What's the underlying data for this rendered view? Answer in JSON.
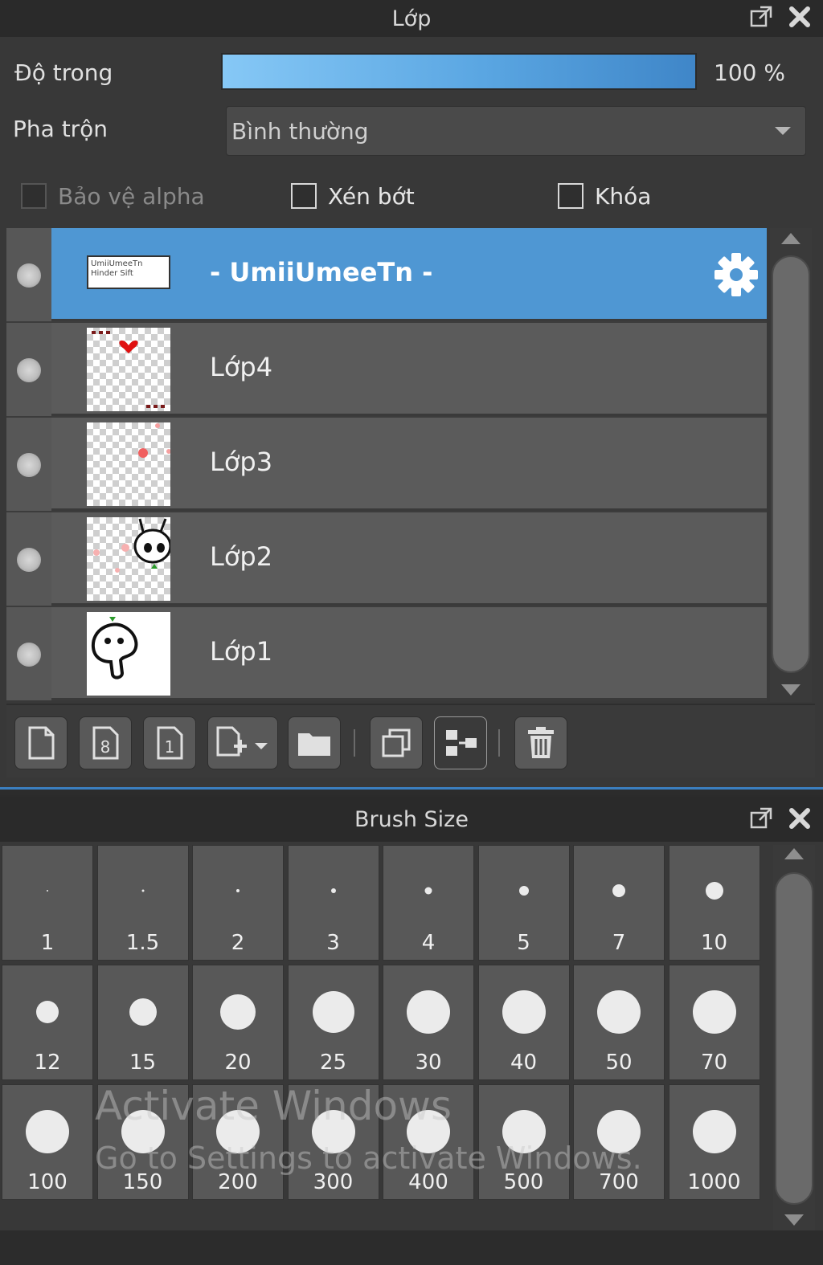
{
  "layer_panel": {
    "title": "Lớp",
    "opacity_label": "Độ trong",
    "opacity_value": "100 %",
    "opacity_fraction": 1.0,
    "blend_label": "Pha trộn",
    "blend_value": "Bình thường",
    "checkboxes": {
      "protect_alpha": "Bảo vệ alpha",
      "clipping": "Xén bớt",
      "lock": "Khóa"
    },
    "layers": [
      {
        "name": "- UmiiUmeeTn -",
        "selected": true,
        "thumb_text": "UmiiUmeeTn Hinder Sift"
      },
      {
        "name": "Lớp4",
        "selected": false
      },
      {
        "name": "Lớp3",
        "selected": false
      },
      {
        "name": "Lớp2",
        "selected": false
      },
      {
        "name": "Lớp1",
        "selected": false
      }
    ],
    "accent_color": "#4f97d3"
  },
  "brush_panel": {
    "title": "Brush Size",
    "sizes": [
      "1",
      "1.5",
      "2",
      "3",
      "4",
      "5",
      "7",
      "10",
      "12",
      "15",
      "20",
      "25",
      "30",
      "40",
      "50",
      "70",
      "100",
      "150",
      "200",
      "300",
      "400",
      "500",
      "700",
      "1000"
    ]
  },
  "watermark": {
    "line1": "Activate Windows",
    "line2": "Go to Settings to activate Windows."
  }
}
